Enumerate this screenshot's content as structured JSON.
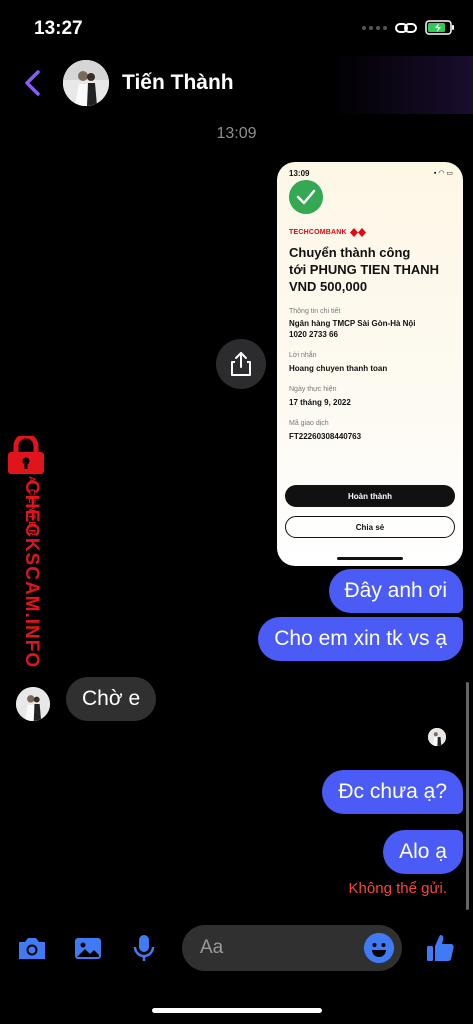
{
  "status_bar": {
    "time": "13:27"
  },
  "header": {
    "contact_name": "Tiến Thành"
  },
  "timestamp": "13:09",
  "receipt": {
    "time": "13:09",
    "bank_name": "TECHCOMBANK",
    "title_line1": "Chuyển thành công",
    "title_line2": "tới PHUNG TIEN THANH",
    "title_line3": "VND 500,000",
    "details_label": "Thông tin chi tiết",
    "bank_value": "Ngân hàng TMCP Sài Gòn-Hà Nội",
    "account_value": "1020 2733 66",
    "message_label": "Lời nhắn",
    "message_value": "Hoang chuyen  thanh toan",
    "date_label": "Ngày thực hiện",
    "date_value": "17 tháng 9, 2022",
    "txn_label": "Mã giao dịch",
    "txn_value": "FT22260308440763",
    "done_button": "Hoàn thành",
    "share_button": "Chia sẻ"
  },
  "messages": [
    {
      "direction": "out",
      "text": "Đây anh ơi"
    },
    {
      "direction": "out",
      "text": "Cho em xin tk vs ạ"
    },
    {
      "direction": "in",
      "text": "Chờ e"
    },
    {
      "direction": "out",
      "text": "Đc chưa ạ?"
    },
    {
      "direction": "out",
      "text": "Alo ạ"
    }
  ],
  "send_error": "Không thể gửi.",
  "watermark": {
    "main": "CHECKSCAM.INFO",
    "sub": "DATA CENTER"
  },
  "composer": {
    "placeholder": "Aa"
  },
  "colors": {
    "outgoing_bubble": "#4a5cf5",
    "incoming_bubble": "#303030",
    "accent": "#3e7bf5",
    "error": "#ff453a",
    "back_arrow": "#8a5cf6"
  }
}
